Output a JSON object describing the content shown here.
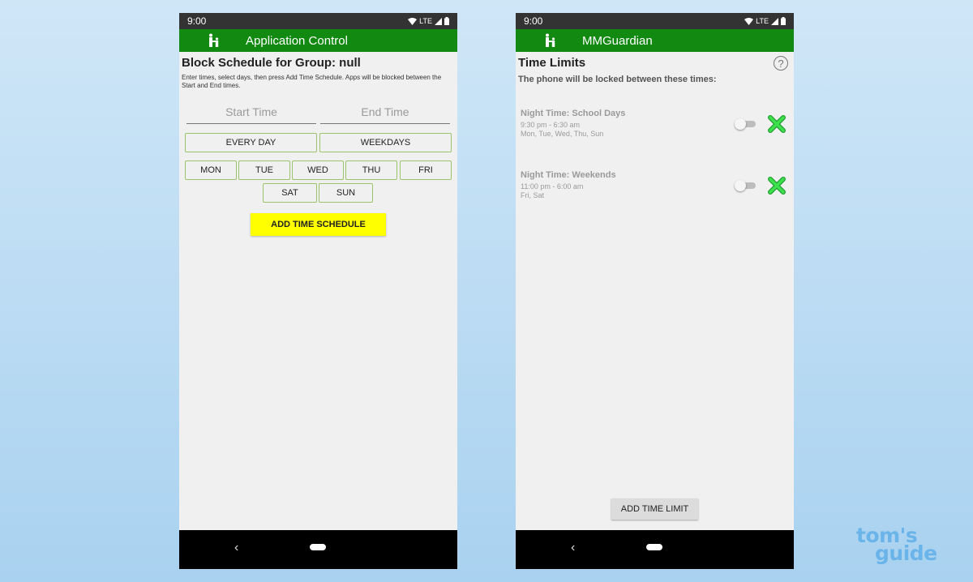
{
  "left_phone": {
    "status_time": "9:00",
    "network": "LTE",
    "app_title": "Application Control",
    "heading": "Block Schedule for Group: null",
    "instructions": "Enter times, select days, then press Add Time Schedule. Apps will be blocked between the Start and End times.",
    "start_placeholder": "Start Time",
    "end_placeholder": "End Time",
    "every_day_label": "EVERY DAY",
    "weekdays_label": "WEEKDAYS",
    "days": [
      "MON",
      "TUE",
      "WED",
      "THU",
      "FRI",
      "SAT",
      "SUN"
    ],
    "add_schedule_label": "ADD TIME SCHEDULE"
  },
  "right_phone": {
    "status_time": "9:00",
    "network": "LTE",
    "app_title": "MMGuardian",
    "heading": "Time Limits",
    "subtitle": "The phone will be locked between these times:",
    "help_glyph": "?",
    "time_limits": [
      {
        "name": "Night Time: School Days",
        "hours": "9:30 pm - 6:30 am",
        "days": "Mon, Tue, Wed, Thu, Sun",
        "enabled": false
      },
      {
        "name": "Night Time: Weekends",
        "hours": "11:00 pm - 6:00 am",
        "days": "Fri, Sat",
        "enabled": false
      }
    ],
    "add_limit_label": "ADD TIME LIMIT"
  },
  "nav": {
    "back_glyph": "‹"
  },
  "watermark": {
    "line1": "tom's",
    "line2": "guide"
  },
  "colors": {
    "app_bar": "#128a12",
    "status_bar": "#333333",
    "schedule_button": "#ffff00",
    "day_button_border": "#9bc36b",
    "delete_icon": "#2ecc40",
    "background": "#bcdcf3"
  }
}
